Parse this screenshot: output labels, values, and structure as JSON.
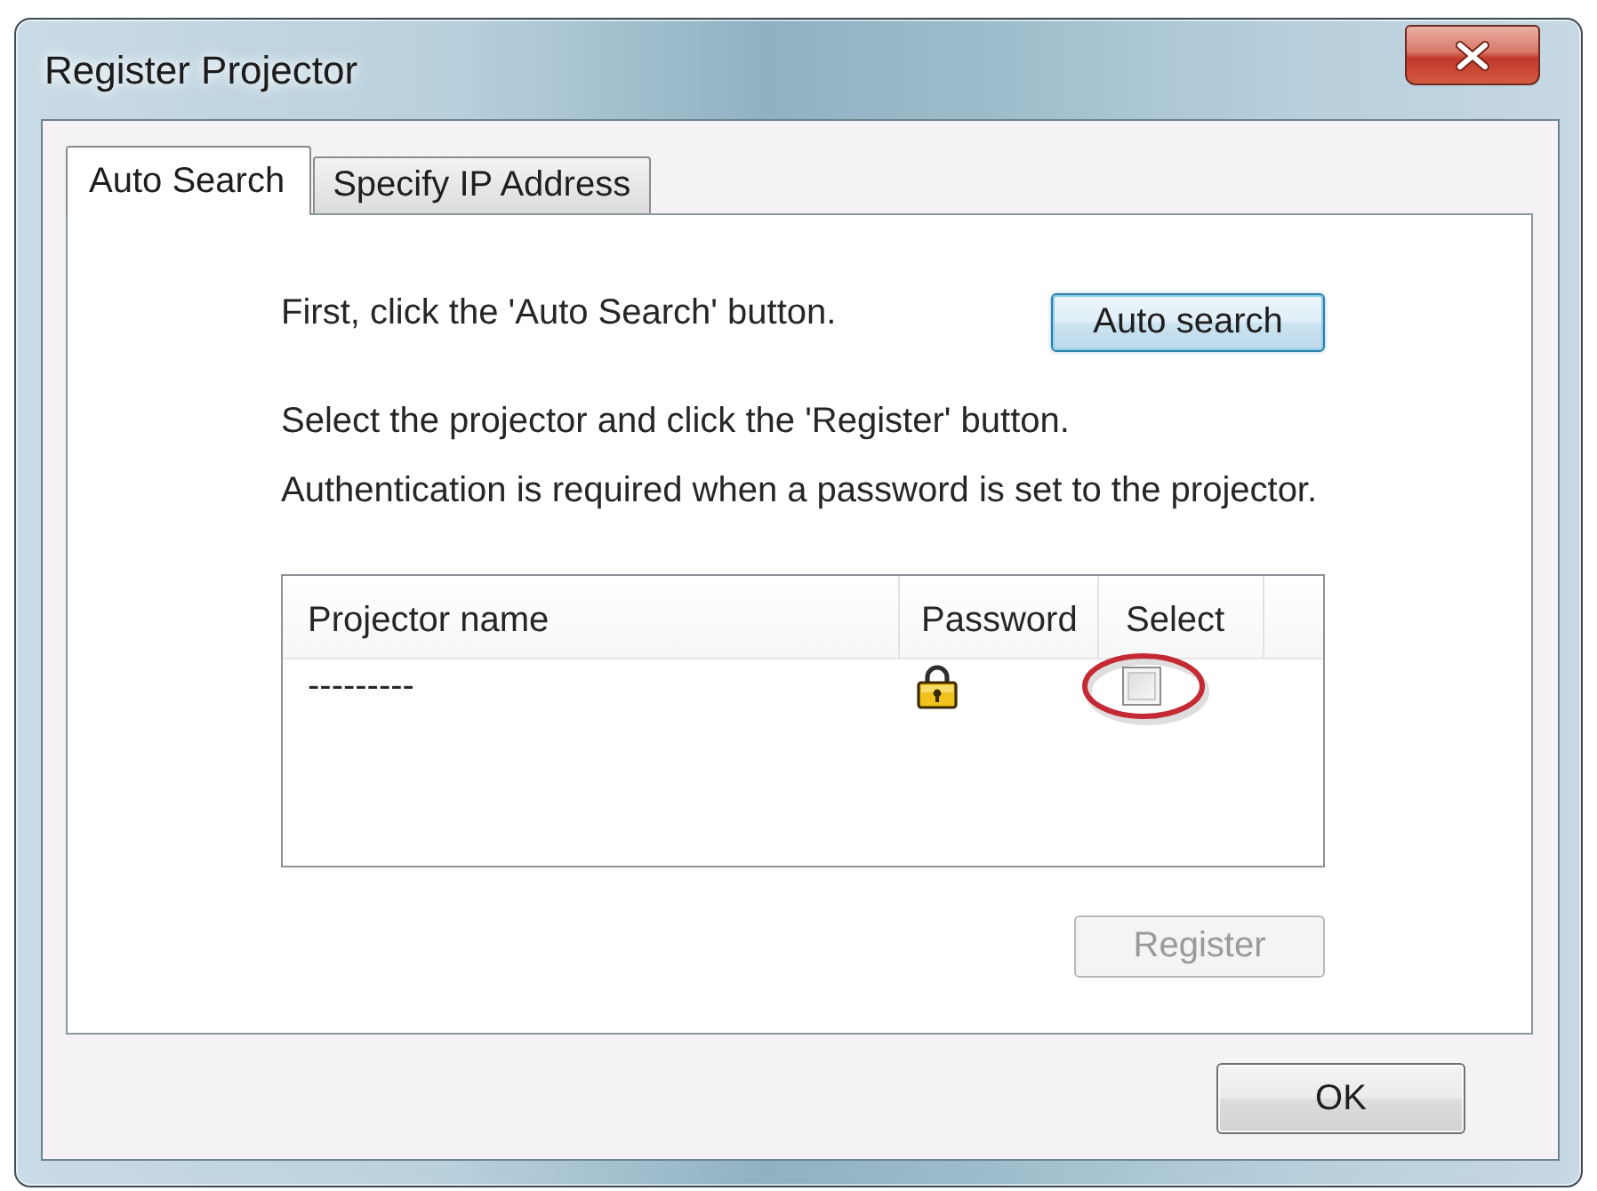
{
  "window": {
    "title": "Register Projector"
  },
  "tabs": [
    {
      "label": "Auto Search",
      "selected": true
    },
    {
      "label": "Specify IP Address",
      "selected": false
    }
  ],
  "instructions": [
    "First, click the 'Auto Search' button.",
    "Select the projector and click the 'Register' button.",
    "Authentication is required when a password is set to the projector."
  ],
  "auto_search_button": {
    "label": "Auto search",
    "focused": true
  },
  "projector_list": {
    "columns": [
      "Projector name",
      "Password",
      "Select"
    ],
    "rows": [
      {
        "name": "---------",
        "locked": true,
        "checked": false,
        "circled": true
      }
    ]
  },
  "register_button": {
    "label": "Register",
    "disabled": true
  },
  "ok_button": {
    "label": "OK"
  }
}
